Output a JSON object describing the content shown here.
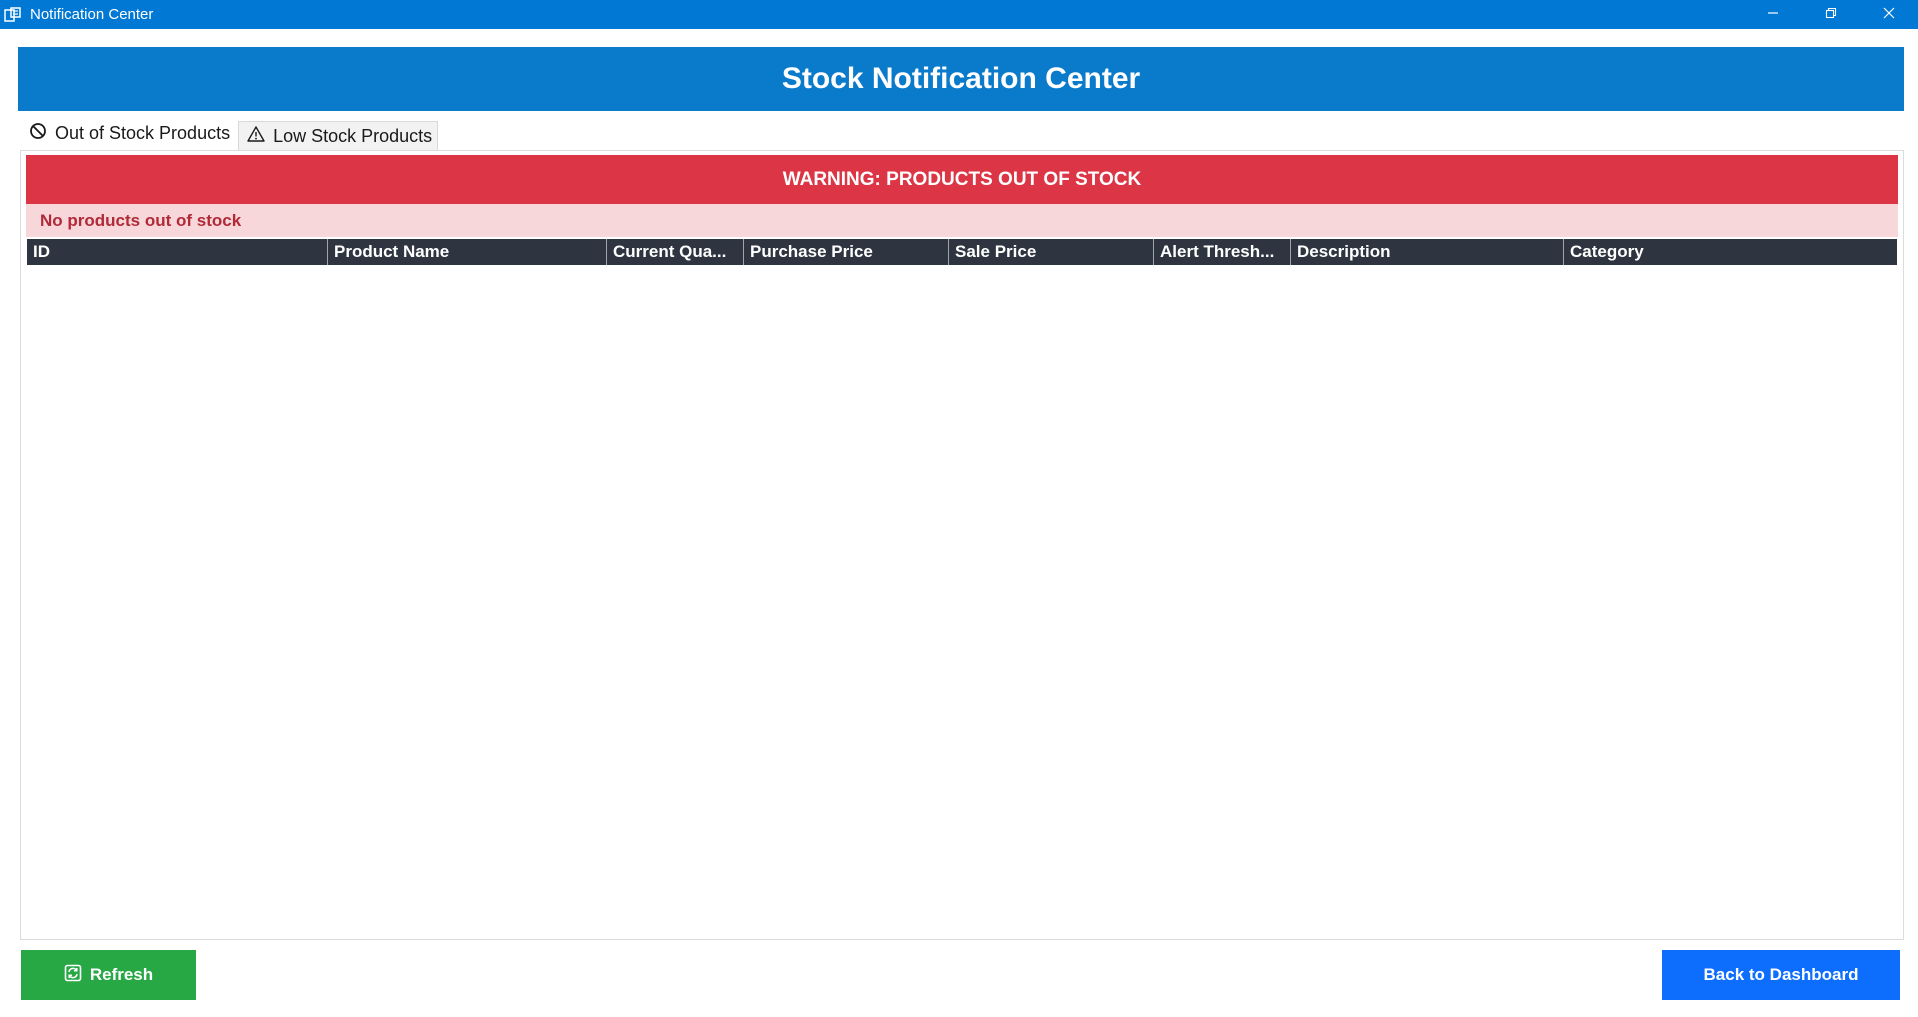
{
  "window": {
    "title": "Notification Center",
    "controls": [
      "minimize-icon",
      "restore-icon",
      "close-icon"
    ]
  },
  "header": {
    "title": "Stock Notification Center"
  },
  "tabs": [
    {
      "label": "Out of Stock Products",
      "icon": "no-entry-icon",
      "active": true
    },
    {
      "label": "Low Stock Products",
      "icon": "warning-triangle-icon",
      "active": false
    }
  ],
  "panel": {
    "warning": "WARNING: PRODUCTS OUT OF STOCK",
    "status": "No products out of stock"
  },
  "table": {
    "columns": [
      "ID",
      "Product Name",
      "Current Qua...",
      "Purchase Price",
      "Sale Price",
      "Alert Thresh...",
      "Description",
      "Category"
    ],
    "rows": []
  },
  "footer": {
    "refresh_label": "Refresh",
    "back_label": "Back to Dashboard"
  },
  "colors": {
    "titlebar": "#0078d4",
    "banner": "#0a7acb",
    "warning": "#dc3545",
    "status_bg": "#f8d7da",
    "status_text": "#b02a37",
    "grid_header": "#2f3540",
    "refresh": "#28a745",
    "back": "#0d6efd"
  }
}
